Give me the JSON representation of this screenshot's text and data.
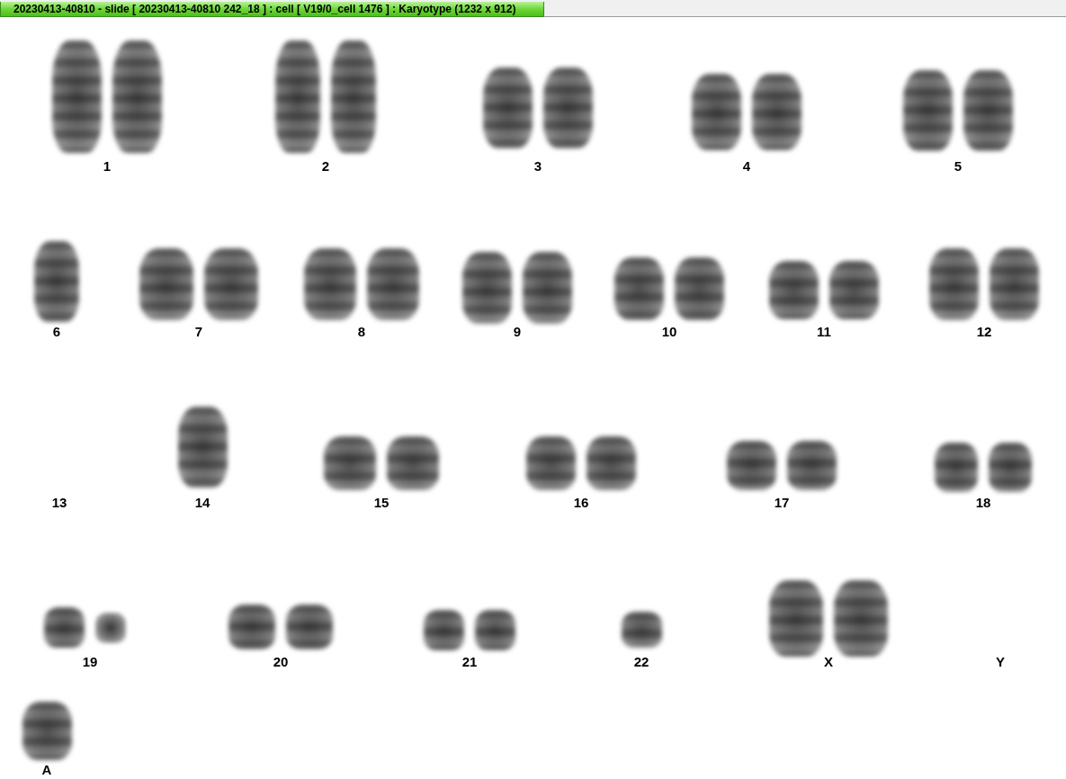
{
  "window": {
    "title": "20230413-40810 - slide [ 20230413-40810 242_18 ] : cell [ V19/0_cell 1476 ] : Karyotype  (1232 x 912)"
  },
  "karyotype": {
    "rows": [
      {
        "groups": [
          {
            "label": "1",
            "items": [
              {
                "kind": "chromosome"
              },
              {
                "kind": "chromosome"
              }
            ]
          },
          {
            "label": "2",
            "items": [
              {
                "kind": "chromosome"
              },
              {
                "kind": "chromosome"
              }
            ]
          },
          {
            "label": "3",
            "items": [
              {
                "kind": "chromosome"
              },
              {
                "kind": "chromosome"
              }
            ]
          },
          {
            "label": "4",
            "items": [
              {
                "kind": "chromosome"
              },
              {
                "kind": "chromosome"
              }
            ]
          },
          {
            "label": "5",
            "items": [
              {
                "kind": "chromosome"
              },
              {
                "kind": "chromosome"
              }
            ]
          }
        ]
      },
      {
        "groups": [
          {
            "label": "6",
            "items": [
              {
                "kind": "chromosome"
              }
            ]
          },
          {
            "label": "7",
            "items": [
              {
                "kind": "chromosome"
              },
              {
                "kind": "chromosome"
              }
            ]
          },
          {
            "label": "8",
            "items": [
              {
                "kind": "chromosome"
              },
              {
                "kind": "chromosome"
              }
            ]
          },
          {
            "label": "9",
            "items": [
              {
                "kind": "chromosome"
              },
              {
                "kind": "chromosome"
              }
            ]
          },
          {
            "label": "10",
            "items": [
              {
                "kind": "chromosome"
              },
              {
                "kind": "chromosome"
              }
            ]
          },
          {
            "label": "11",
            "items": [
              {
                "kind": "chromosome"
              },
              {
                "kind": "chromosome"
              }
            ]
          },
          {
            "label": "12",
            "items": [
              {
                "kind": "chromosome"
              },
              {
                "kind": "chromosome"
              }
            ]
          }
        ]
      },
      {
        "groups": [
          {
            "label": "13"
          },
          {
            "label": "14",
            "items": [
              {
                "kind": "chromosome"
              }
            ]
          },
          {
            "label": "15",
            "items": [
              {
                "kind": "chromosome"
              },
              {
                "kind": "chromosome"
              }
            ]
          },
          {
            "label": "16",
            "items": [
              {
                "kind": "chromosome"
              },
              {
                "kind": "chromosome"
              }
            ]
          },
          {
            "label": "17",
            "items": [
              {
                "kind": "chromosome"
              },
              {
                "kind": "chromosome"
              }
            ]
          },
          {
            "label": "18",
            "items": [
              {
                "kind": "chromosome"
              },
              {
                "kind": "chromosome"
              }
            ]
          }
        ]
      },
      {
        "groups": [
          {
            "label": "19",
            "items": [
              {
                "kind": "chromosome"
              },
              {
                "kind": "small-chromosome"
              }
            ]
          },
          {
            "label": "20",
            "items": [
              {
                "kind": "chromosome"
              },
              {
                "kind": "chromosome"
              }
            ]
          },
          {
            "label": "21",
            "items": [
              {
                "kind": "chromosome"
              },
              {
                "kind": "chromosome"
              }
            ]
          },
          {
            "label": "22",
            "items": [
              {
                "kind": "chromosome"
              }
            ]
          },
          {
            "label": "X",
            "items": [
              {
                "kind": "chromosome"
              },
              {
                "kind": "chromosome"
              }
            ]
          },
          {
            "label": "Y"
          }
        ]
      },
      {
        "groups": [
          {
            "label": "A",
            "items": [
              {
                "kind": "chromosome"
              }
            ]
          }
        ]
      }
    ]
  }
}
